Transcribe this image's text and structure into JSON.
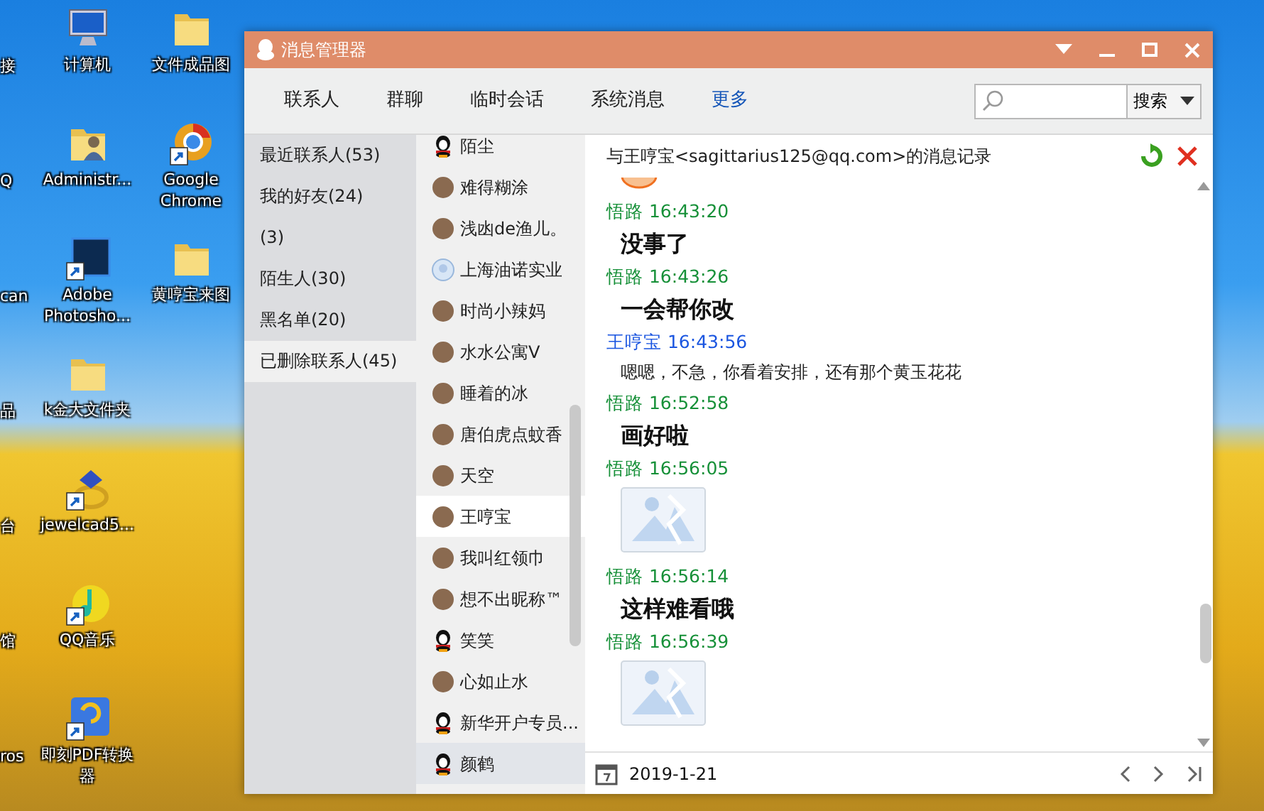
{
  "desktop_columns": [
    {
      "icons": [
        {
          "label": "接",
          "kind": "cut"
        },
        {
          "label": "Q",
          "kind": "cut"
        },
        {
          "label": "can",
          "kind": "cut"
        },
        {
          "label": "品",
          "kind": "cut"
        },
        {
          "label": "台",
          "kind": "cut"
        },
        {
          "label": "馆",
          "kind": "cut"
        },
        {
          "label": "ros",
          "kind": "cut"
        }
      ]
    },
    {
      "icons": [
        {
          "label": "计算机",
          "kind": "computer"
        },
        {
          "label": "Administr...",
          "kind": "user-folder"
        },
        {
          "label": "Adobe Photosho...",
          "kind": "photoshop"
        },
        {
          "label": "k金大文件夹",
          "kind": "folder"
        },
        {
          "label": "jewelcad5...",
          "kind": "jewel"
        },
        {
          "label": "QQ音乐",
          "kind": "music"
        },
        {
          "label": "即刻PDF转换器",
          "kind": "pdf"
        }
      ]
    },
    {
      "icons": [
        {
          "label": "文件成品图",
          "kind": "folder"
        },
        {
          "label": "Google Chrome",
          "kind": "chrome"
        },
        {
          "label": "黄哼宝来图",
          "kind": "folder"
        }
      ]
    }
  ],
  "window": {
    "title": "消息管理器",
    "tabs": [
      {
        "label": "联系人",
        "selected": false
      },
      {
        "label": "群聊",
        "selected": false
      },
      {
        "label": "临时会话",
        "selected": false
      },
      {
        "label": "系统消息",
        "selected": false
      }
    ],
    "more_link": "更多",
    "search": {
      "button": "搜索"
    },
    "groups": [
      {
        "label": "最近联系人(53)",
        "selected": false
      },
      {
        "label": "我的好友(24)",
        "selected": false
      },
      {
        "label": "(3)",
        "selected": false
      },
      {
        "label": "陌生人(30)",
        "selected": false
      },
      {
        "label": "黑名单(20)",
        "selected": false
      },
      {
        "label": "已删除联系人(45)",
        "selected": true
      }
    ],
    "contacts": [
      {
        "name": "陌尘",
        "kind": "penguin",
        "selected": false,
        "hovered": false
      },
      {
        "name": "难得糊涂",
        "kind": "picture",
        "selected": false,
        "hovered": false
      },
      {
        "name": "浅凼de渔儿。",
        "kind": "picture",
        "selected": false,
        "hovered": false
      },
      {
        "name": "上海油诺实业",
        "kind": "default",
        "selected": false,
        "hovered": false
      },
      {
        "name": "时尚小辣妈",
        "kind": "picture",
        "selected": false,
        "hovered": false
      },
      {
        "name": "水水公寓V",
        "kind": "picture",
        "selected": false,
        "hovered": false
      },
      {
        "name": "睡着的冰",
        "kind": "picture",
        "selected": false,
        "hovered": false
      },
      {
        "name": "唐伯虎点蚊香",
        "kind": "picture",
        "selected": false,
        "hovered": false
      },
      {
        "name": "天空",
        "kind": "picture",
        "selected": false,
        "hovered": false
      },
      {
        "name": "王哼宝",
        "kind": "picture",
        "selected": true,
        "hovered": false
      },
      {
        "name": "我叫红领巾",
        "kind": "picture",
        "selected": false,
        "hovered": false
      },
      {
        "name": "想不出昵称™",
        "kind": "picture",
        "selected": false,
        "hovered": false
      },
      {
        "name": "笑笑",
        "kind": "penguin",
        "selected": false,
        "hovered": false
      },
      {
        "name": "心如止水",
        "kind": "picture",
        "selected": false,
        "hovered": false
      },
      {
        "name": "新华开户专员...",
        "kind": "penguin",
        "selected": false,
        "hovered": false
      },
      {
        "name": "颜鹤",
        "kind": "penguin",
        "selected": false,
        "hovered": true
      }
    ],
    "conversation": {
      "title": "与王哼宝<sagittarius125@qq.com>的消息记录",
      "messages": [
        {
          "kind": "sticker"
        },
        {
          "kind": "big_text",
          "header": "悟路 16:43:20",
          "color": "#169038",
          "text": "没事了"
        },
        {
          "kind": "big_text",
          "header": "悟路 16:43:26",
          "color": "#169038",
          "text": "一会帮你改"
        },
        {
          "kind": "text",
          "header": "王哼宝 16:43:56",
          "color": "#1a55e0",
          "text": "嗯嗯，不急，你看着安排，还有那个黄玉花花"
        },
        {
          "kind": "big_text",
          "header": "悟路 16:52:58",
          "color": "#169038",
          "text": "画好啦"
        },
        {
          "kind": "image",
          "header": "悟路 16:56:05",
          "color": "#169038"
        },
        {
          "kind": "big_text",
          "header": "悟路 16:56:14",
          "color": "#169038",
          "text": "这样难看哦"
        },
        {
          "kind": "image",
          "header": "悟路 16:56:39",
          "color": "#169038"
        }
      ]
    },
    "date": "2019-1-21"
  }
}
